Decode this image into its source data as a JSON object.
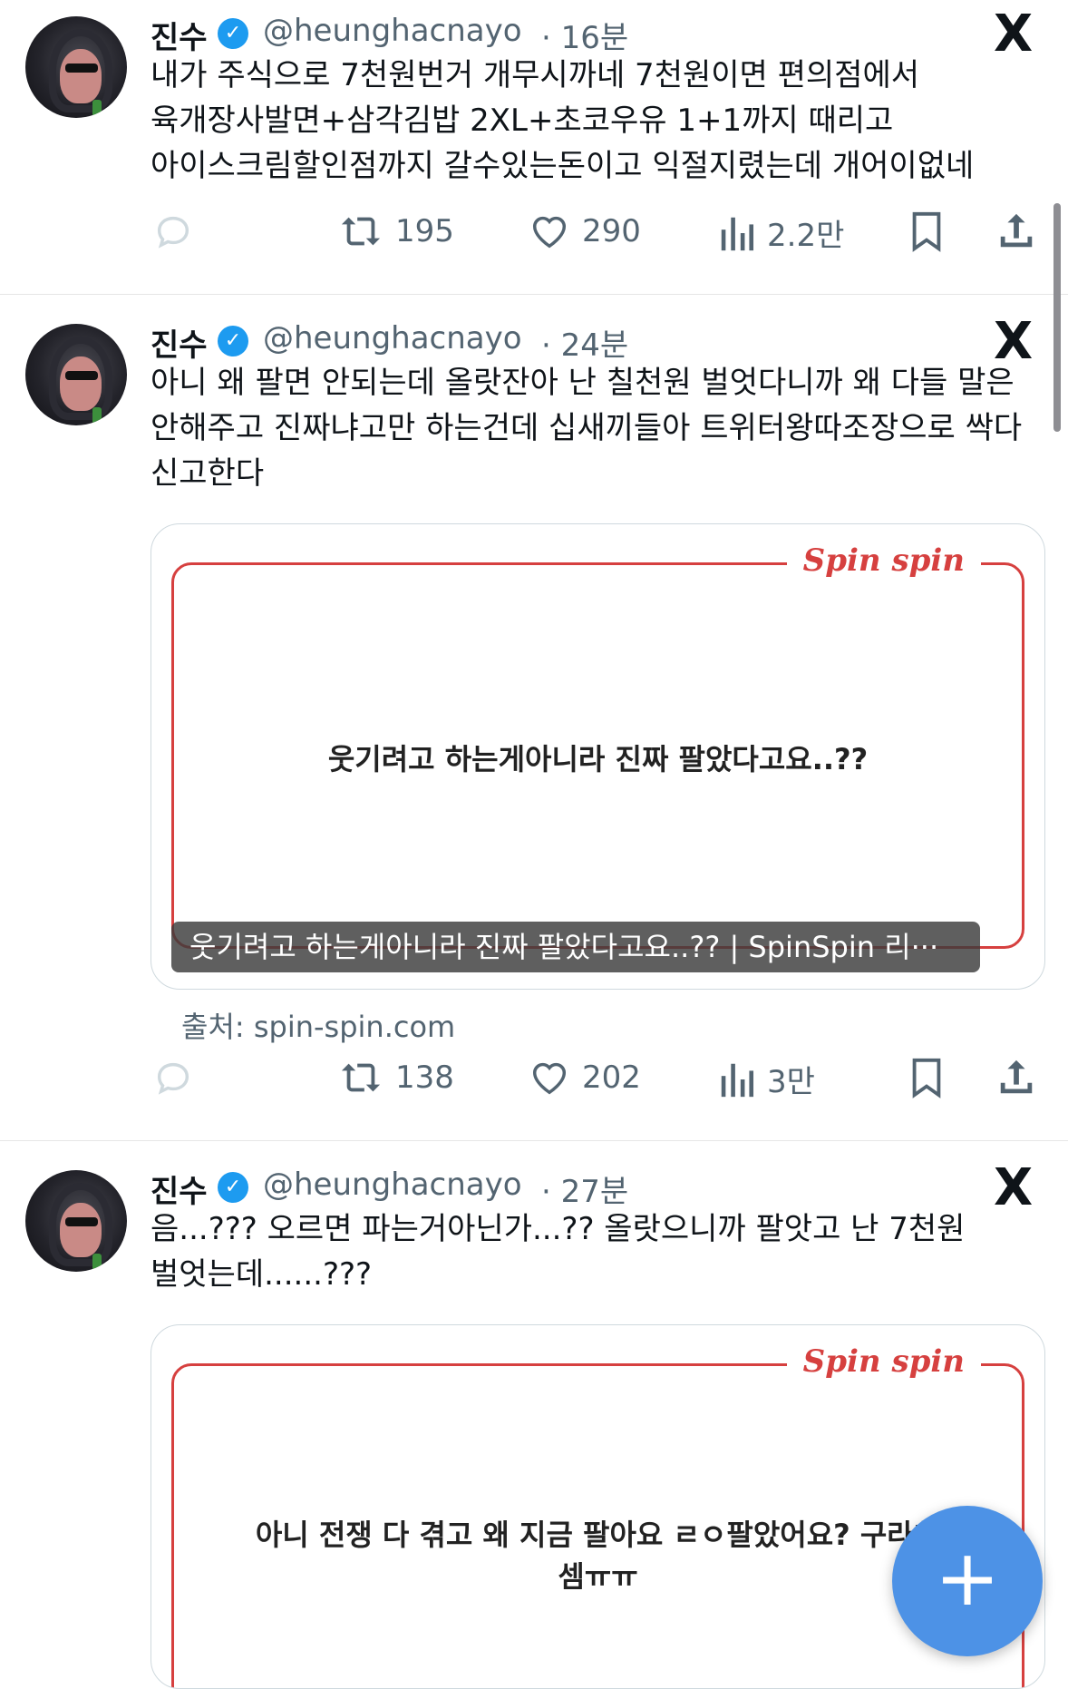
{
  "tweets": [
    {
      "name": "진수",
      "handle": "@heunghacnayo",
      "time": "· 16분",
      "text": "내가 주식으로 7천원번거 개무시까네 7천원이면 편의점에서 육개장사발면+삼각김밥 2XL+초코우유 1+1까지 때리고 아이스크림할인점까지 갈수있는돈이고 익절지렸는데 개어이없네",
      "retweets": "195",
      "likes": "290",
      "views": "2.2만"
    },
    {
      "name": "진수",
      "handle": "@heunghacnayo",
      "time": "· 24분",
      "text": "아니 왜 팔면 안되는데 올랏잔아 난 칠천원 벌엇다니까 왜 다들 말은 안해주고 진짜냐고만 하는건데 십새끼들아 트위터왕따조장으로 싹다 신고한다",
      "card_brand": "Spin spin",
      "card_text": "웃기려고 하는게아니라 진짜 팔았다고요..??",
      "card_caption": "웃기려고 하는게아니라 진짜 팔았다고요..?? | SpinSpin 리···",
      "source": "출처: spin-spin.com",
      "retweets": "138",
      "likes": "202",
      "views": "3만"
    },
    {
      "name": "진수",
      "handle": "@heunghacnayo",
      "time": "· 27분",
      "text": "음...??? 오르면 파는거아닌가...?? 올랏으니까 팔앗고 난 7천원 벌엇는데......???",
      "card_brand": "Spin spin",
      "card_text_line1": "아니 전쟁 다 겪고 왜 지금 팔아요 ㄹㅇ팔았어요? 구라치",
      "card_text_line2": "셈ㅠㅠ"
    }
  ],
  "icons": {
    "reply": "reply-icon",
    "retweet": "retweet-icon",
    "like": "heart-icon",
    "views": "views-icon",
    "bookmark": "bookmark-icon",
    "share": "share-icon",
    "verified": "verified-badge-icon",
    "x": "x-logo-icon",
    "compose": "compose-plus-icon"
  },
  "x_logo": "X",
  "fab_label": "+",
  "colors": {
    "accent": "#1d9bf0",
    "fab": "#4d92e6",
    "card_red": "#d6403f",
    "muted": "#536471"
  }
}
